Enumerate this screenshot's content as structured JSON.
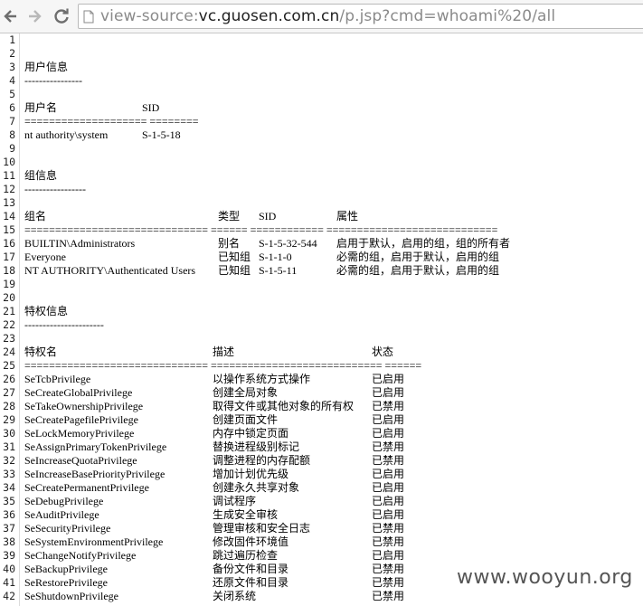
{
  "toolbar": {
    "url_scheme": "view-source:",
    "url_host": "vc.guosen.com.cn",
    "url_path": "/p.jsp?cmd=whoami%20/all"
  },
  "lines": [
    {
      "n": "1",
      "c": []
    },
    {
      "n": "2",
      "c": []
    },
    {
      "n": "3",
      "c": [
        "用户信息"
      ]
    },
    {
      "n": "4",
      "c": [
        "----------------"
      ]
    },
    {
      "n": "5",
      "c": []
    },
    {
      "n": "6",
      "c": [
        "用户名",
        "SID"
      ]
    },
    {
      "n": "7",
      "c": [
        "==================== ========"
      ]
    },
    {
      "n": "8",
      "c": [
        "nt authority\\system",
        "S-1-5-18"
      ]
    },
    {
      "n": "9",
      "c": []
    },
    {
      "n": "10",
      "c": []
    },
    {
      "n": "11",
      "c": [
        "组信息"
      ]
    },
    {
      "n": "12",
      "c": [
        "-----------------"
      ]
    },
    {
      "n": "13",
      "c": []
    },
    {
      "n": "14",
      "c": [
        "组名",
        "类型",
        "SID",
        "属性"
      ]
    },
    {
      "n": "15",
      "c": [
        "============================== ====== ============ ============================"
      ]
    },
    {
      "n": "16",
      "c": [
        "BUILTIN\\Administrators",
        "别名",
        "S-1-5-32-544",
        "启用于默认，启用的组，组的所有者"
      ]
    },
    {
      "n": "17",
      "c": [
        "Everyone",
        "已知组",
        "S-1-1-0",
        "必需的组，启用于默认，启用的组"
      ]
    },
    {
      "n": "18",
      "c": [
        "NT AUTHORITY\\Authenticated Users",
        "已知组",
        "S-1-5-11",
        "必需的组，启用于默认，启用的组"
      ]
    },
    {
      "n": "19",
      "c": []
    },
    {
      "n": "20",
      "c": []
    },
    {
      "n": "21",
      "c": [
        "特权信息"
      ]
    },
    {
      "n": "22",
      "c": [
        "----------------------"
      ]
    },
    {
      "n": "23",
      "c": []
    },
    {
      "n": "24",
      "c": [
        "特权名",
        "描述",
        "状态"
      ]
    },
    {
      "n": "25",
      "c": [
        "============================== ============================ ======"
      ]
    },
    {
      "n": "26",
      "c": [
        "SeTcbPrivilege",
        "以操作系统方式操作",
        "已启用"
      ]
    },
    {
      "n": "27",
      "c": [
        "SeCreateGlobalPrivilege",
        "创建全局对象",
        "已启用"
      ]
    },
    {
      "n": "28",
      "c": [
        "SeTakeOwnershipPrivilege",
        "取得文件或其他对象的所有权",
        "已禁用"
      ]
    },
    {
      "n": "29",
      "c": [
        "SeCreatePagefilePrivilege",
        "创建页面文件",
        "已启用"
      ]
    },
    {
      "n": "30",
      "c": [
        "SeLockMemoryPrivilege",
        "内存中锁定页面",
        "已启用"
      ]
    },
    {
      "n": "31",
      "c": [
        "SeAssignPrimaryTokenPrivilege",
        "替换进程级别标记",
        "已禁用"
      ]
    },
    {
      "n": "32",
      "c": [
        "SeIncreaseQuotaPrivilege",
        "调整进程的内存配额",
        "已禁用"
      ]
    },
    {
      "n": "33",
      "c": [
        "SeIncreaseBasePriorityPrivilege",
        "增加计划优先级",
        "已启用"
      ]
    },
    {
      "n": "34",
      "c": [
        "SeCreatePermanentPrivilege",
        "创建永久共享对象",
        "已启用"
      ]
    },
    {
      "n": "35",
      "c": [
        "SeDebugPrivilege",
        "调试程序",
        "已启用"
      ]
    },
    {
      "n": "36",
      "c": [
        "SeAuditPrivilege",
        "生成安全审核",
        "已启用"
      ]
    },
    {
      "n": "37",
      "c": [
        "SeSecurityPrivilege",
        "管理审核和安全日志",
        "已禁用"
      ]
    },
    {
      "n": "38",
      "c": [
        "SeSystemEnvironmentPrivilege",
        "修改固件环境值",
        "已禁用"
      ]
    },
    {
      "n": "39",
      "c": [
        "SeChangeNotifyPrivilege",
        "跳过遍历检查",
        "已启用"
      ]
    },
    {
      "n": "40",
      "c": [
        "SeBackupPrivilege",
        "备份文件和目录",
        "已禁用"
      ]
    },
    {
      "n": "41",
      "c": [
        "SeRestorePrivilege",
        "还原文件和目录",
        "已禁用"
      ]
    },
    {
      "n": "42",
      "c": [
        "SeShutdownPrivilege",
        "关闭系统",
        "已禁用"
      ]
    }
  ],
  "watermark": "www.wooyun.org"
}
